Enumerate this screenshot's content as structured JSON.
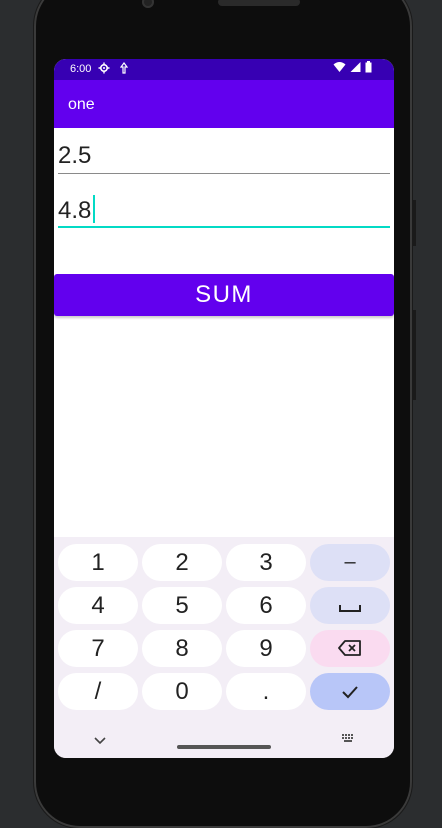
{
  "status_bar": {
    "time": "6:00",
    "left_icons": [
      "settings-icon",
      "data-saver-icon"
    ],
    "right_icons": [
      "wifi-icon",
      "signal-icon",
      "battery-icon"
    ]
  },
  "app_bar": {
    "title": "one"
  },
  "form": {
    "first_value": "2.5",
    "second_value": "4.8",
    "sum_button_label": "SUM"
  },
  "keyboard": {
    "rows": [
      [
        "1",
        "2",
        "3",
        "–"
      ],
      [
        "4",
        "5",
        "6",
        "␣"
      ],
      [
        "7",
        "8",
        "9",
        "⌫"
      ],
      [
        "/",
        "0",
        ".",
        "✓"
      ]
    ],
    "nav": {
      "hide_icon": "chevron-down-icon",
      "switch_icon": "keyboard-icon"
    }
  },
  "colors": {
    "status_bar": "#3700b3",
    "primary": "#6200ee",
    "accent": "#03dac5",
    "keyboard_bg": "#f3eef6"
  }
}
